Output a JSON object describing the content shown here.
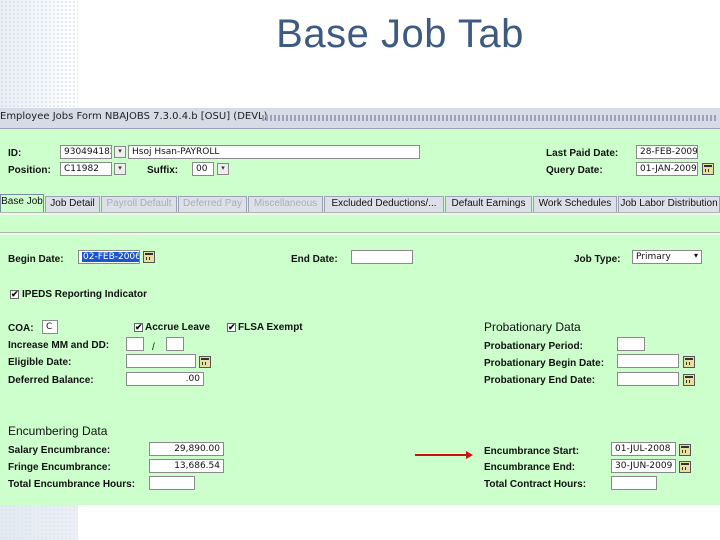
{
  "slide_title": "Base Job Tab",
  "window_title": "Employee Jobs Form  NBAJOBS  7.3.0.4.b  [OSU]  (DEVL)",
  "header": {
    "id_label": "ID:",
    "id_value": "930494182",
    "name_value": "Hsoj Hsan-PAYROLL",
    "position_label": "Position:",
    "position_value": "C11982",
    "suffix_label": "Suffix:",
    "suffix_value": "00",
    "last_paid_label": "Last Paid Date:",
    "last_paid_value": "28-FEB-2009",
    "query_date_label": "Query Date:",
    "query_date_value": "01-JAN-2009"
  },
  "tabs": [
    {
      "label": "Base Job",
      "state": "active"
    },
    {
      "label": "Job Detail",
      "state": "enabled"
    },
    {
      "label": "Payroll Default",
      "state": "disabled"
    },
    {
      "label": "Deferred Pay",
      "state": "disabled"
    },
    {
      "label": "Miscellaneous",
      "state": "disabled"
    },
    {
      "label": "Excluded Deductions/...",
      "state": "enabled"
    },
    {
      "label": "Default Earnings",
      "state": "enabled"
    },
    {
      "label": "Work Schedules",
      "state": "enabled"
    },
    {
      "label": "Job Labor Distribution",
      "state": "enabled"
    }
  ],
  "main": {
    "begin_date_label": "Begin Date:",
    "begin_date_value": "02-FEB-2006",
    "end_date_label": "End Date:",
    "end_date_value": "",
    "job_type_label": "Job Type:",
    "job_type_value": "Primary",
    "ipeds_label": "IPEDS Reporting  Indicator",
    "ipeds_checked": true,
    "coa_label": "COA:",
    "coa_value": "C",
    "accrue_leave_label": "Accrue Leave",
    "accrue_leave_checked": true,
    "flsa_label": "FLSA Exempt",
    "flsa_checked": true,
    "increase_label": "Increase MM and DD:",
    "increase_mm": "",
    "increase_sep": "/",
    "increase_dd": "",
    "eligible_label": "Eligible Date:",
    "eligible_value": "",
    "deferred_label": "Deferred Balance:",
    "deferred_value": ".00",
    "checkmark": "✔"
  },
  "probationary": {
    "title": "Probationary Data",
    "period_label": "Probationary Period:",
    "period_value": "",
    "begin_label": "Probationary Begin Date:",
    "begin_value": "",
    "end_label": "Probationary End Date:",
    "end_value": ""
  },
  "encumbering": {
    "title": "Encumbering Data",
    "salary_label": "Salary Encumbrance:",
    "salary_value": "29,890.00",
    "fringe_label": "Fringe Encumbrance:",
    "fringe_value": "13,686.54",
    "total_hours_label": "Total Encumbrance Hours:",
    "total_hours_value": "",
    "start_label": "Encumbrance Start:",
    "start_value": "01-JUL-2008",
    "end_label": "Encumbrance End:",
    "end_value": "30-JUN-2009",
    "contract_hours_label": "Total Contract Hours:",
    "contract_hours_value": ""
  },
  "colors": {
    "form_background": "#ccffcc",
    "title_color": "#3d5a80",
    "arrow_color": "#cc1111",
    "selection": "#1a55cc"
  }
}
